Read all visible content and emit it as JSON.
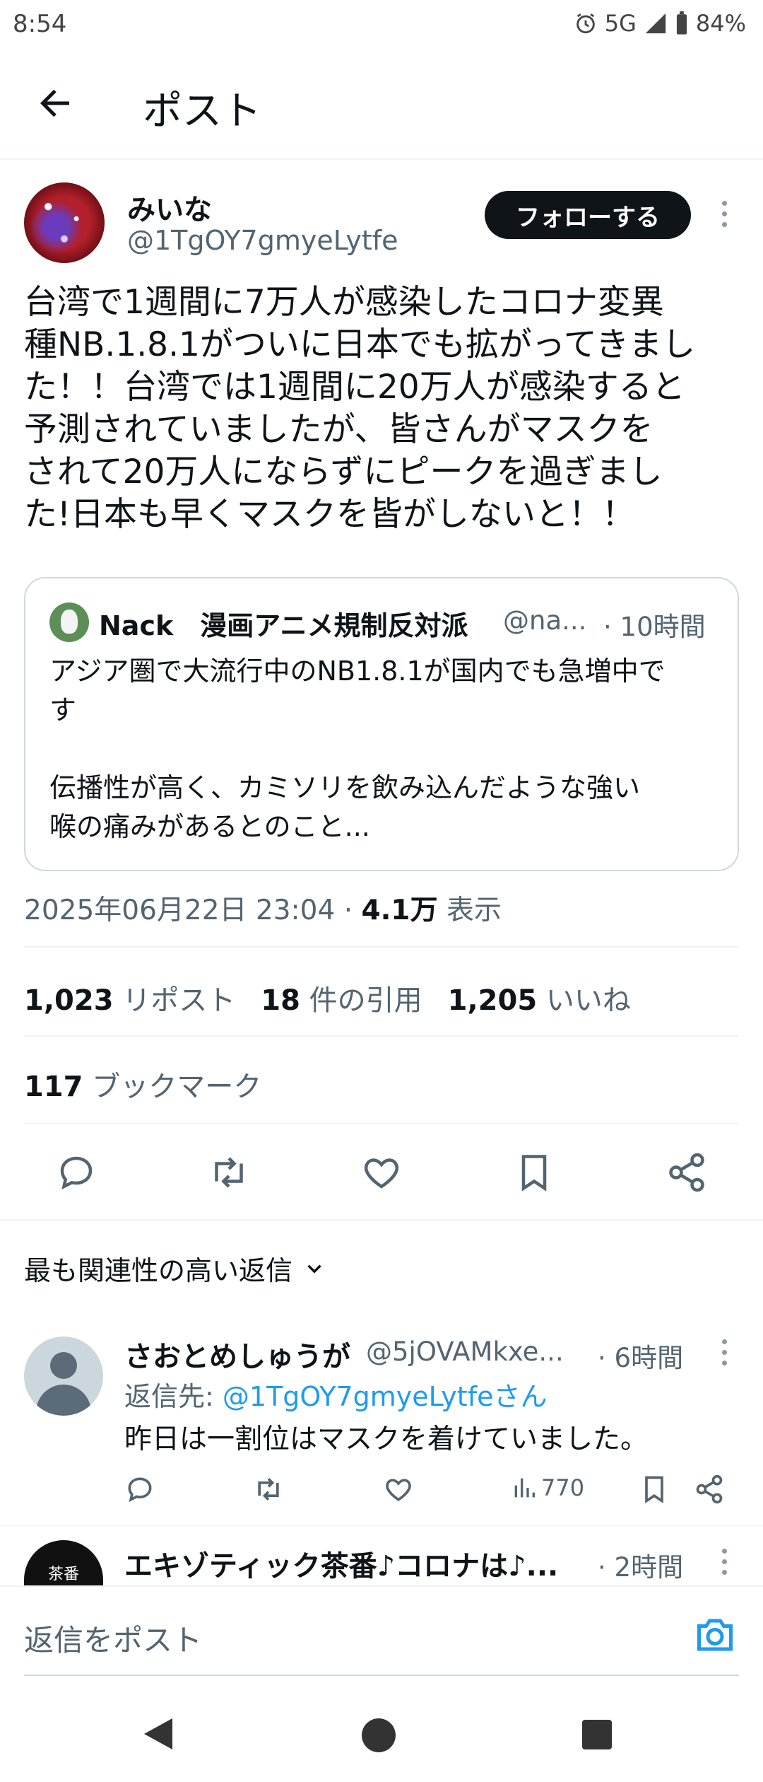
{
  "status_bar": {
    "time": "8:54",
    "network": "5G",
    "battery": "84%",
    "alarm_icon": "alarm-icon",
    "signal_icon": "signal-icon",
    "battery_icon": "battery-icon"
  },
  "header": {
    "title": "ポスト",
    "back_icon": "arrow-left-icon"
  },
  "post": {
    "author_name": "みいな",
    "author_handle": "@1TgOY7gmyeLytfe",
    "follow_label": "フォローする",
    "text": "台湾で1週間に7万人が感染したコロナ変異\n種NB.1.8.1がついに日本でも拡がってきまし\nた！！台湾では1週間に20万人が感染すると\n予測されていましたが、皆さんがマスクを\nされて20万人にならずにピークを過ぎまし\nた!日本も早くマスクを皆がしないと！！",
    "quote": {
      "author_name": "Nack　漫画アニメ規制反対派",
      "author_handle": "@na...",
      "time": "· 10時間",
      "text": "アジア圏で大流行中のNB1.8.1が国内でも急増中で\nす\n\n伝播性が高く、カミソリを飲み込んだような強い\n喉の痛みがあるとのこと..."
    },
    "timestamp": "2025年06月22日 23:04 · ",
    "views_count": "4.1万",
    "views_label": " 表示",
    "reposts_count": "1,023",
    "reposts_label": "リポスト",
    "quotes_count": "18",
    "quotes_label": "件の引用",
    "likes_count": "1,205",
    "likes_label": "いいね",
    "bookmarks_count": "117",
    "bookmarks_label": "ブックマーク"
  },
  "actions": [
    "reply-icon",
    "repost-icon",
    "like-icon",
    "bookmark-icon",
    "share-icon"
  ],
  "replies": {
    "sort_label": "最も関連性の高い返信",
    "items": [
      {
        "name": "さおとめしゅうが",
        "handle": "@5jOVAMkxe...",
        "time": "· 6時間",
        "reply_to_prefix": "返信先: ",
        "reply_to": "@1TgOY7gmyeLytfeさん",
        "text": "昨日は一割位はマスクを着けていました。",
        "views": "770"
      },
      {
        "name": "エキゾティック茶番♪コロナは♪...",
        "time": "· 2時間",
        "avatar_text": "茶番"
      }
    ]
  },
  "composer": {
    "placeholder": "返信をポスト",
    "camera_icon": "camera-icon"
  },
  "colors": {
    "accent": "#1d9bf0",
    "text": "#0f1419",
    "secondary": "#536471",
    "divider": "#eff3f4"
  }
}
